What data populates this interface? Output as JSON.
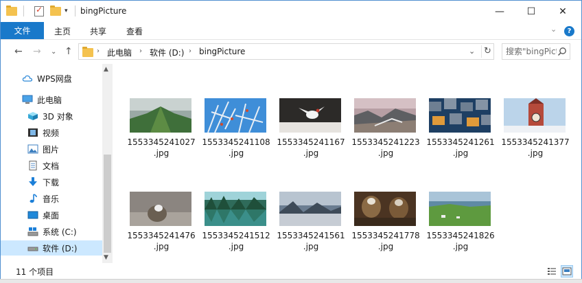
{
  "window": {
    "title": "bingPicture",
    "controls": {
      "minimize": "—",
      "maximize": "☐",
      "close": "✕"
    }
  },
  "ribbon": {
    "tabs": [
      "文件",
      "主页",
      "共享",
      "查看"
    ],
    "help": "?"
  },
  "address": {
    "crumbs": [
      "此电脑",
      "软件 (D:)",
      "bingPicture"
    ],
    "search_placeholder": "搜索\"bingPicture\""
  },
  "nav": {
    "items": [
      {
        "label": "WPS网盘",
        "icon": "cloud-icon"
      },
      {
        "label": "此电脑",
        "icon": "computer-icon"
      },
      {
        "label": "3D 对象",
        "icon": "3d-objects-icon"
      },
      {
        "label": "视频",
        "icon": "video-icon"
      },
      {
        "label": "图片",
        "icon": "pictures-icon"
      },
      {
        "label": "文档",
        "icon": "documents-icon"
      },
      {
        "label": "下载",
        "icon": "download-icon"
      },
      {
        "label": "音乐",
        "icon": "music-icon"
      },
      {
        "label": "桌面",
        "icon": "desktop-icon"
      },
      {
        "label": "系统 (C:)",
        "icon": "drive-c-icon"
      },
      {
        "label": "软件 (D:)",
        "icon": "drive-d-icon",
        "selected": true
      }
    ]
  },
  "files": [
    {
      "name": "1553345241027",
      "ext": ".jpg",
      "thumb": "green-mountain-ridge"
    },
    {
      "name": "1553345241108",
      "ext": ".jpg",
      "thumb": "frosted-branches-blue-sky"
    },
    {
      "name": "1553345241167",
      "ext": ".jpg",
      "thumb": "white-bird-in-snow"
    },
    {
      "name": "1553345241223",
      "ext": ".jpg",
      "thumb": "mountain-town-valley"
    },
    {
      "name": "1553345241261",
      "ext": ".jpg",
      "thumb": "concrete-blocks-memorial"
    },
    {
      "name": "1553345241377",
      "ext": ".jpg",
      "thumb": "clock-tower-snow"
    },
    {
      "name": "1553345241476",
      "ext": ".jpg",
      "thumb": "animal-close-up"
    },
    {
      "name": "1553345241512",
      "ext": ".jpg",
      "thumb": "forest-lake-reflection"
    },
    {
      "name": "1553345241561",
      "ext": ".jpg",
      "thumb": "lake-mountains-clouds"
    },
    {
      "name": "1553345241778",
      "ext": ".jpg",
      "thumb": "falconers-with-birds"
    },
    {
      "name": "1553345241826",
      "ext": ".jpg",
      "thumb": "green-coast-island"
    }
  ],
  "status": {
    "item_count": "11 个项目"
  }
}
